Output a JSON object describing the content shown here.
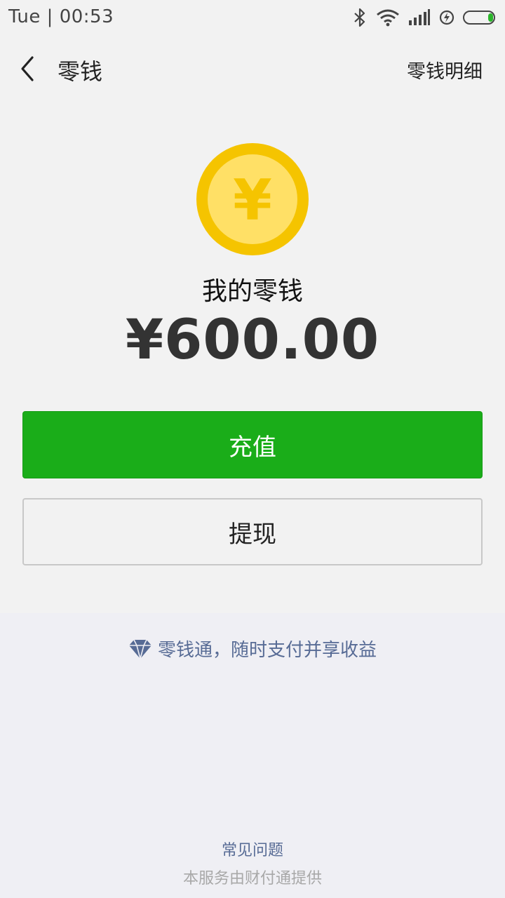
{
  "status_bar": {
    "time": "Tue | 00:53",
    "icons": [
      "bluetooth-icon",
      "wifi-icon",
      "signal-icon",
      "charging-icon",
      "battery-icon"
    ]
  },
  "nav": {
    "back_icon": "chevron-left-icon",
    "title": "零钱",
    "detail_link": "零钱明细"
  },
  "balance": {
    "coin_icon": "yuan-coin-icon",
    "coin_symbol": "¥",
    "label": "我的零钱",
    "amount": "¥600.00"
  },
  "actions": {
    "recharge_label": "充值",
    "withdraw_label": "提现"
  },
  "promo": {
    "icon": "diamond-icon",
    "text": "零钱通，随时支付并享收益"
  },
  "footer": {
    "faq_link": "常见问题",
    "provider_text": "本服务由财付通提供"
  },
  "colors": {
    "primary_green": "#1aad19",
    "link_blue": "#576b95",
    "coin_outer": "#f5c400",
    "coin_inner": "#ffe066"
  }
}
